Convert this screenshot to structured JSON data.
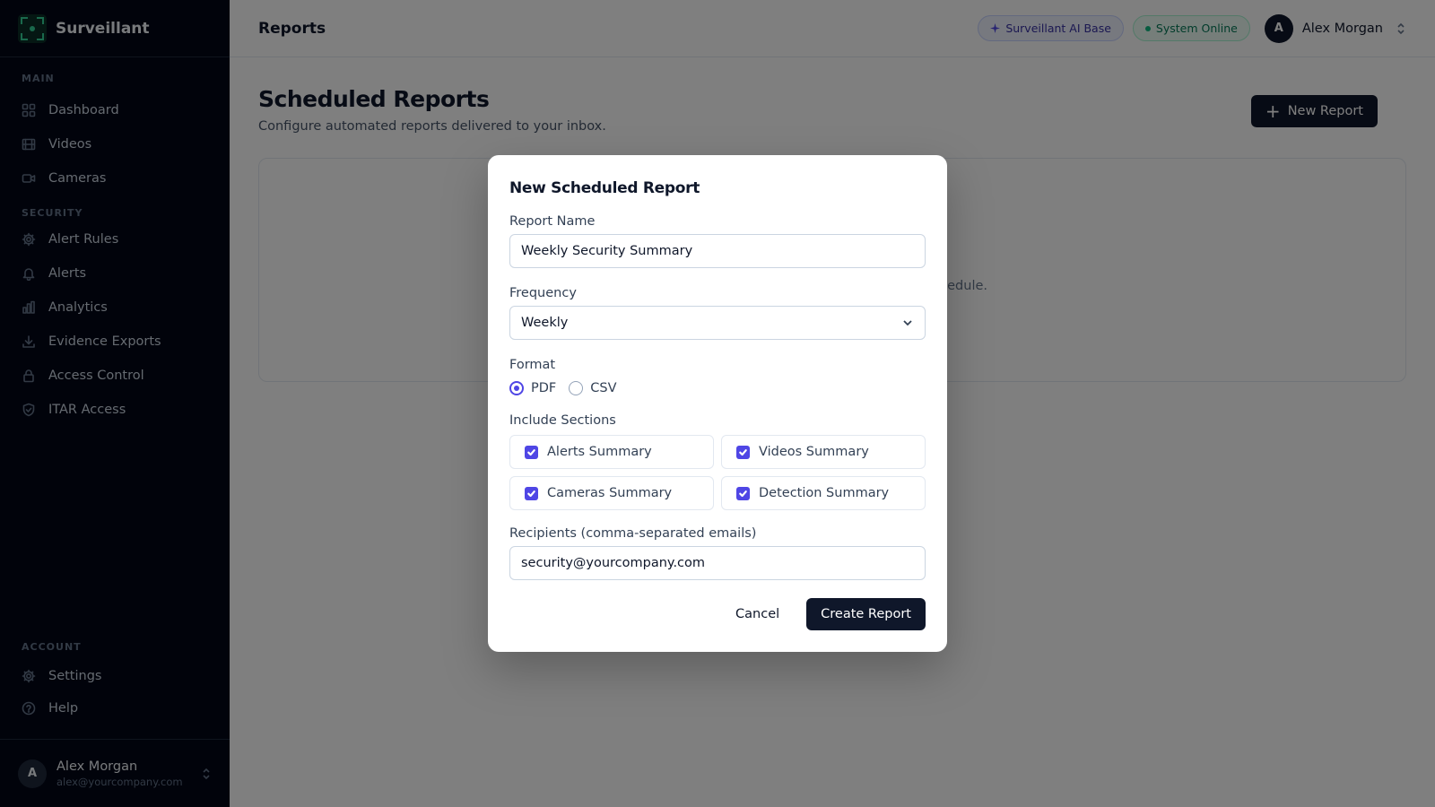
{
  "app": {
    "name": "Surveillant"
  },
  "sidebar": {
    "sections": [
      {
        "label": "MAIN",
        "items": [
          {
            "label": "Dashboard",
            "icon": "grid-icon"
          },
          {
            "label": "Videos",
            "icon": "film-icon"
          },
          {
            "label": "Cameras",
            "icon": "camera-icon"
          }
        ]
      },
      {
        "label": "SECURITY",
        "items": [
          {
            "label": "Alert Rules",
            "icon": "gear-icon"
          },
          {
            "label": "Alerts",
            "icon": "bell-icon"
          },
          {
            "label": "Analytics",
            "icon": "bar-chart-icon"
          },
          {
            "label": "Evidence Exports",
            "icon": "download-icon"
          },
          {
            "label": "Access Control",
            "icon": "lock-icon"
          },
          {
            "label": "ITAR Access",
            "icon": "shield-icon"
          }
        ]
      }
    ],
    "account": {
      "label": "ACCOUNT",
      "items": [
        {
          "label": "Settings",
          "icon": "gear-icon"
        },
        {
          "label": "Help",
          "icon": "help-circle-icon"
        }
      ]
    },
    "user": {
      "initial": "A",
      "name": "Alex Morgan",
      "email": "alex@yourcompany.com"
    }
  },
  "topbar": {
    "title": "Reports",
    "ai_badge": "Surveillant AI Base",
    "status_badge": "System Online",
    "user": {
      "initial": "A",
      "name": "Alex Morgan"
    }
  },
  "page": {
    "title": "Scheduled Reports",
    "subtitle": "Configure automated reports delivered to your inbox.",
    "new_report_label": "New Report",
    "empty_text_fragment": "edule."
  },
  "modal": {
    "title": "New Scheduled Report",
    "report_name_label": "Report Name",
    "report_name_value": "Weekly Security Summary",
    "frequency_label": "Frequency",
    "frequency_value": "Weekly",
    "format_label": "Format",
    "format_options": [
      {
        "label": "PDF",
        "selected": true
      },
      {
        "label": "CSV",
        "selected": false
      }
    ],
    "sections_label": "Include Sections",
    "sections": [
      {
        "label": "Alerts Summary",
        "checked": true
      },
      {
        "label": "Videos Summary",
        "checked": true
      },
      {
        "label": "Cameras Summary",
        "checked": true
      },
      {
        "label": "Detection Summary",
        "checked": true
      }
    ],
    "recipients_label": "Recipients (comma-separated emails)",
    "recipients_value": "security@yourcompany.com",
    "cancel_label": "Cancel",
    "create_label": "Create Report"
  },
  "colors": {
    "accent": "#4f46e5",
    "primary": "#0f172a",
    "sidebar_bg": "#020617",
    "success": "#10b981"
  }
}
